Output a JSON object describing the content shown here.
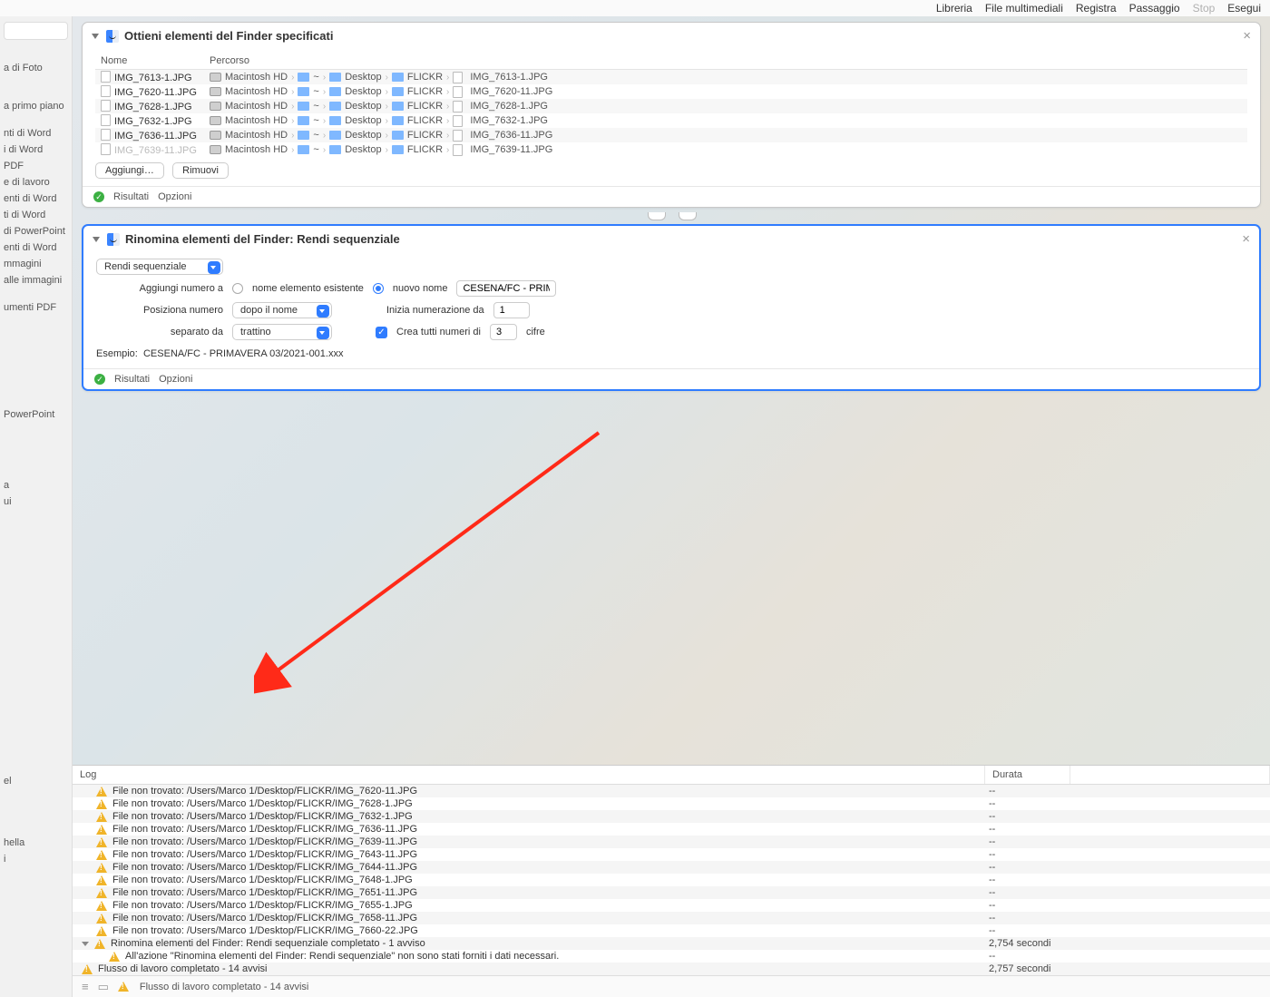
{
  "toolbar": {
    "items": [
      "Libreria",
      "File multimediali",
      "Registra",
      "Passaggio",
      "Stop",
      "Esegui"
    ],
    "disabled_index": 4
  },
  "sidebar": {
    "items_top": [
      "a di Foto"
    ],
    "items_mid": [
      "a primo piano"
    ],
    "items_block": [
      "nti di Word",
      "i di Word",
      "PDF",
      "e di lavoro",
      "enti di Word",
      "ti di Word",
      "di PowerPoint",
      "enti di Word",
      "mmagini",
      "alle immagini"
    ],
    "items_after": [
      "umenti PDF"
    ],
    "items_pp": [
      "PowerPoint"
    ],
    "items_bottom": [
      "a",
      "ui"
    ],
    "items_tail1": [
      "el"
    ],
    "items_tail2": [
      "hella",
      "i"
    ]
  },
  "action1": {
    "title": "Ottieni elementi del Finder specificati",
    "columns": [
      "Nome",
      "Percorso"
    ],
    "hd_label": "Macintosh HD",
    "home": "~",
    "desktop": "Desktop",
    "flickr": "FLICKR",
    "rows": [
      {
        "name": "IMG_7613-1.JPG",
        "target": "IMG_7613-1.JPG"
      },
      {
        "name": "IMG_7620-11.JPG",
        "target": "IMG_7620-11.JPG"
      },
      {
        "name": "IMG_7628-1.JPG",
        "target": "IMG_7628-1.JPG"
      },
      {
        "name": "IMG_7632-1.JPG",
        "target": "IMG_7632-1.JPG"
      },
      {
        "name": "IMG_7636-11.JPG",
        "target": "IMG_7636-11.JPG"
      }
    ],
    "row_faded": {
      "name": "IMG_7639-11.JPG",
      "target": "IMG_7639-11.JPG"
    },
    "add_btn": "Aggiungi…",
    "remove_btn": "Rimuovi",
    "foot_results": "Risultati",
    "foot_options": "Opzioni"
  },
  "action2": {
    "title": "Rinomina elementi del Finder: Rendi sequenziale",
    "mode": "Rendi sequenziale",
    "add_number_label": "Aggiungi numero a",
    "radio_existing": "nome elemento esistente",
    "radio_new": "nuovo nome",
    "new_name_value": "CESENA/FC - PRIMAV",
    "position_label": "Posiziona numero",
    "position_value": "dopo il nome",
    "start_label": "Inizia numerazione da",
    "start_value": "1",
    "sep_label": "separato da",
    "sep_value": "trattino",
    "digits_check_label": "Crea tutti numeri di",
    "digits_value": "3",
    "digits_suffix": "cifre",
    "example_label": "Esempio:",
    "example_value": "CESENA/FC - PRIMAVERA 03/2021-001.xxx",
    "foot_results": "Risultati",
    "foot_options": "Opzioni"
  },
  "log": {
    "header_log": "Log",
    "header_durata": "Durata",
    "prefix": "File non trovato: ",
    "path_prefix": "/Users/Marco 1/Desktop/FLICKR/",
    "files": [
      "IMG_7620-11.JPG",
      "IMG_7628-1.JPG",
      "IMG_7632-1.JPG",
      "IMG_7636-11.JPG",
      "IMG_7639-11.JPG",
      "IMG_7643-11.JPG",
      "IMG_7644-11.JPG",
      "IMG_7648-1.JPG",
      "IMG_7651-11.JPG",
      "IMG_7655-1.JPG",
      "IMG_7658-11.JPG",
      "IMG_7660-22.JPG"
    ],
    "dash": "--",
    "parent_msg": "Rinomina elementi del Finder: Rendi sequenziale completato - 1 avviso",
    "parent_duration": "2,754 secondi",
    "child_msg": "All'azione \"Rinomina elementi del Finder: Rendi sequenziale\" non sono stati forniti i dati necessari.",
    "final_msg": "Flusso di lavoro completato - 14 avvisi",
    "final_duration": "2,757 secondi"
  },
  "status": {
    "msg": "Flusso di lavoro completato - 14 avvisi"
  }
}
